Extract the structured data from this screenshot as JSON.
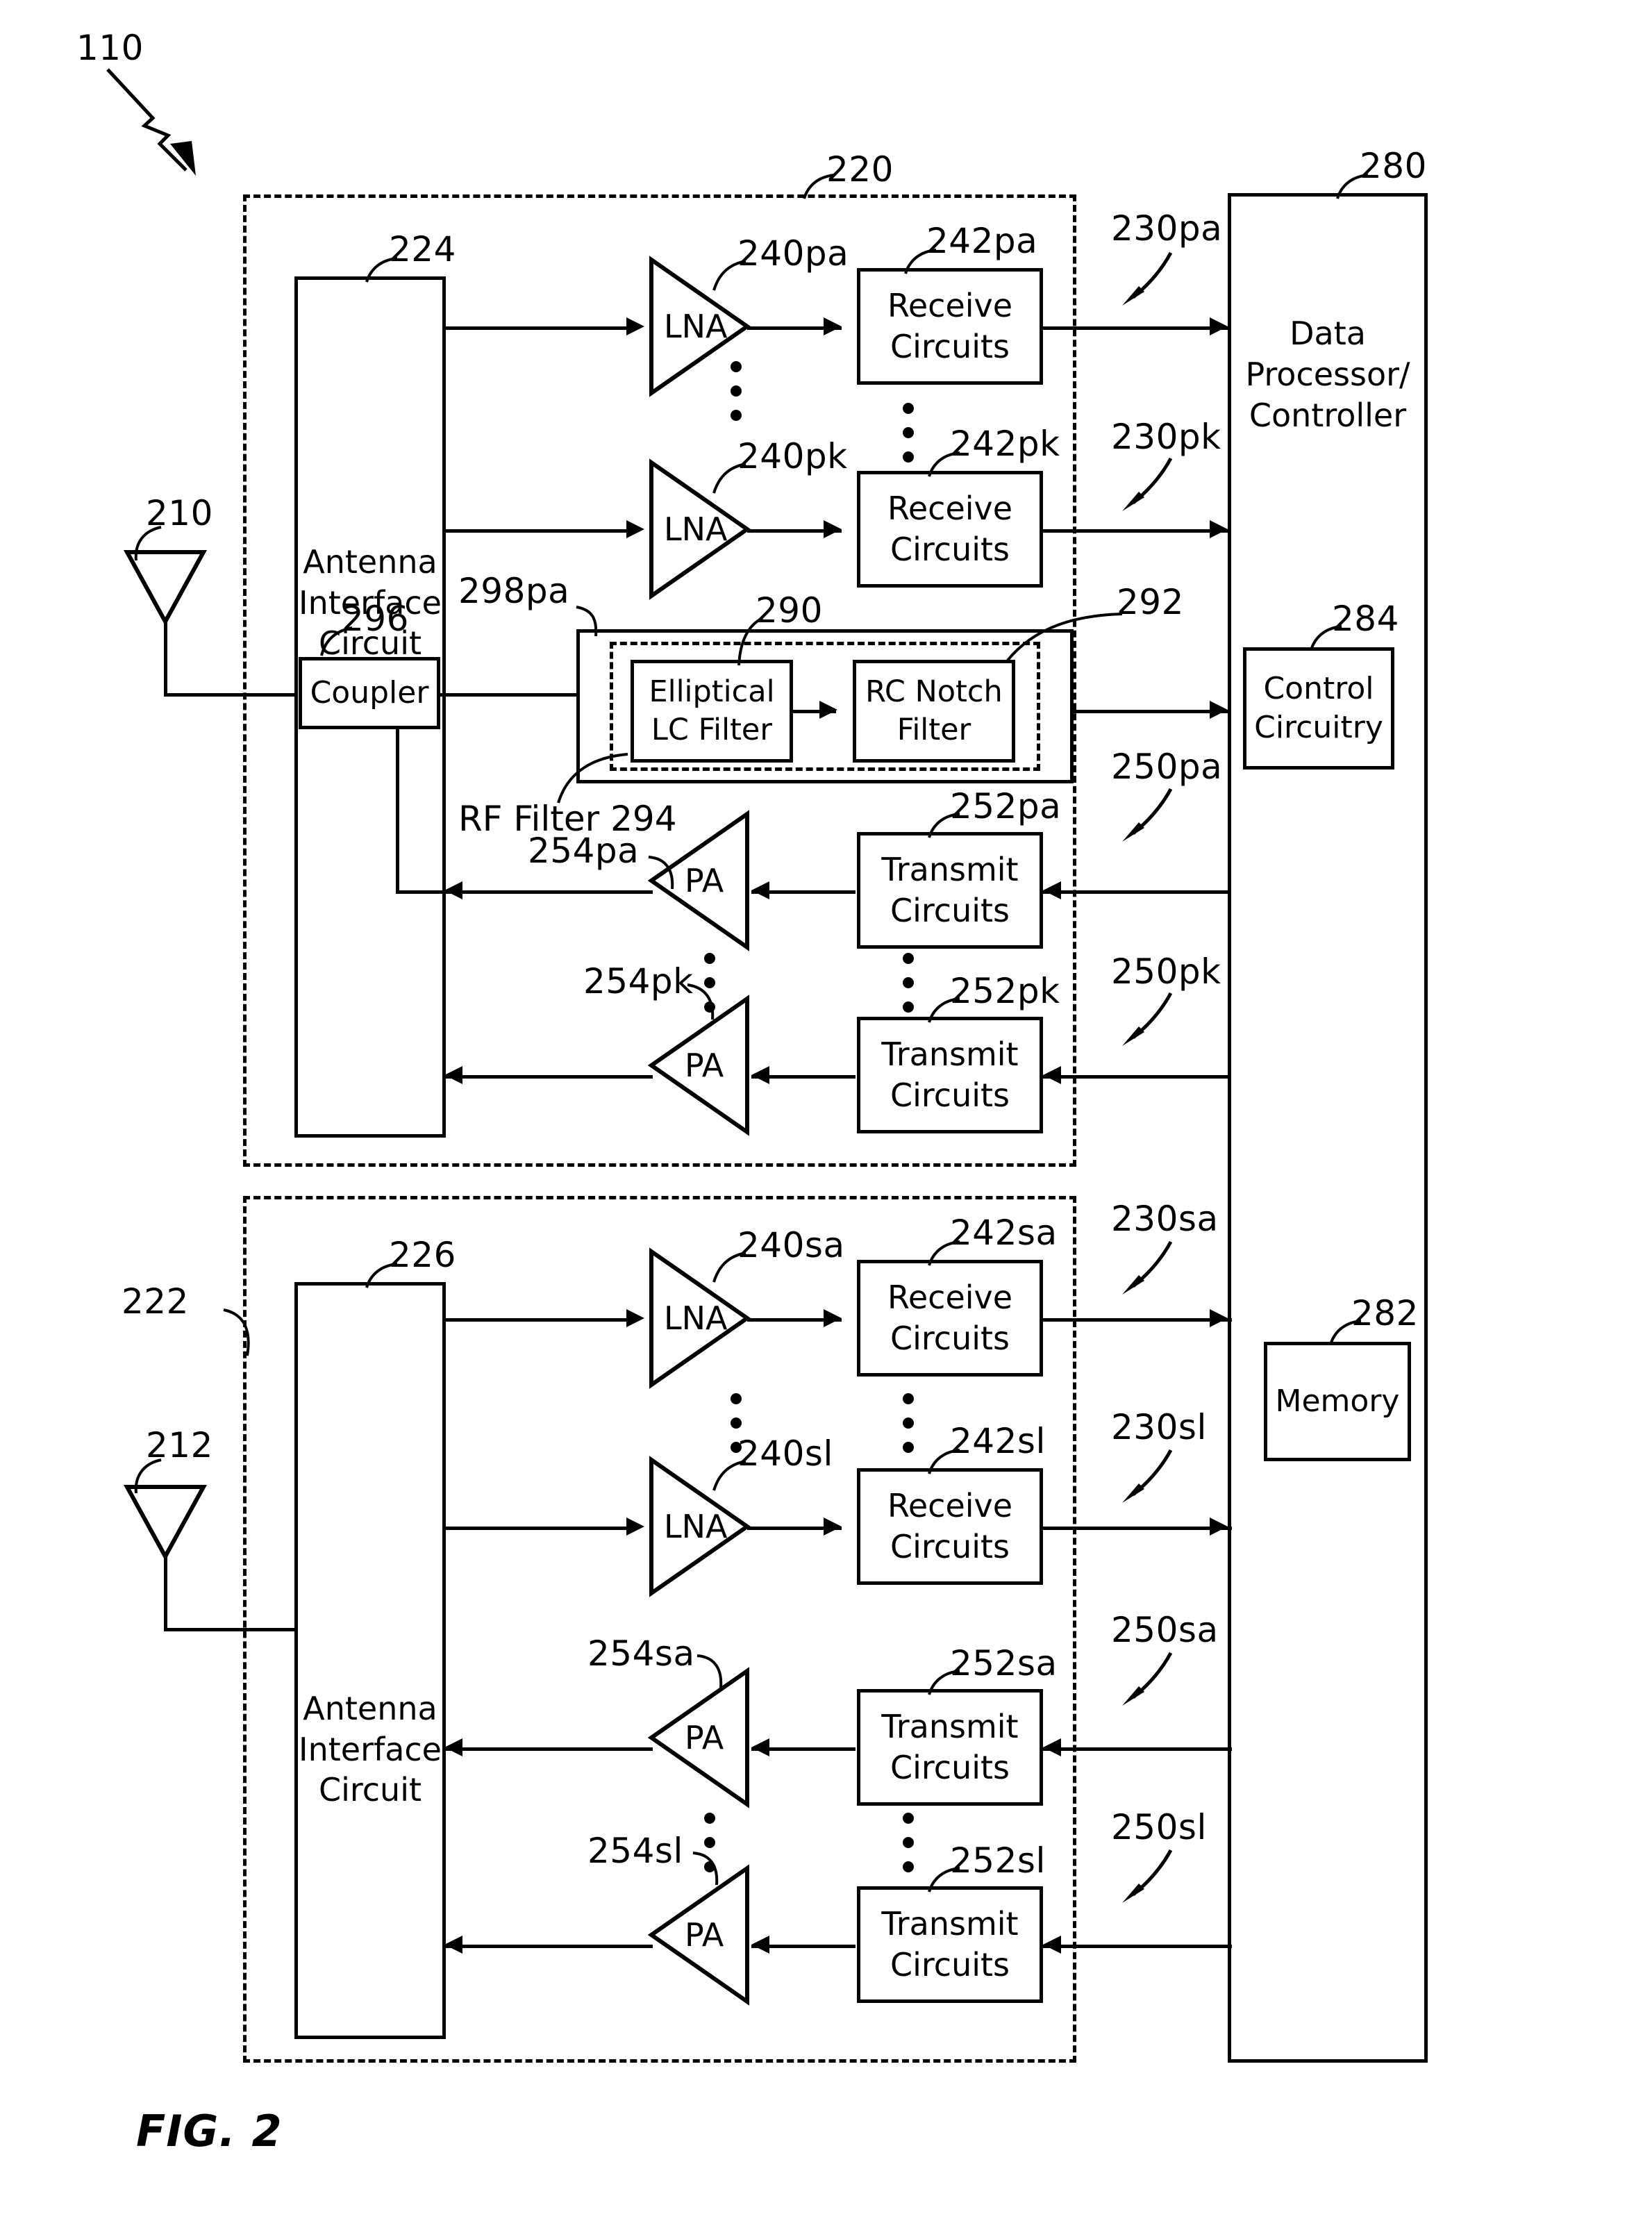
{
  "figure": {
    "caption": "FIG. 2",
    "title_ref": "110"
  },
  "refs": {
    "device": "110",
    "primary_transceiver": "220",
    "secondary_transceiver": "222",
    "antenna_primary": "210",
    "antenna_secondary": "212",
    "aic_primary": "224",
    "aic_secondary": "226",
    "coupler": "296",
    "rf_filter_path": "298pa",
    "elliptical_filter": "290",
    "rc_notch_filter": "292",
    "rf_filter": "RF Filter 294",
    "data_processor": "280",
    "memory": "282",
    "control_circuitry": "284",
    "lna_pa_first": "240pa",
    "lna_pa_last": "240pk",
    "rx_pa_first": "242pa",
    "rx_pa_last": "242pk",
    "rx_out_pa_first": "230pa",
    "rx_out_pa_last": "230pk",
    "pa_amp_first": "254pa",
    "pa_amp_last": "254pk",
    "tx_pa_first": "252pa",
    "tx_pa_last": "252pk",
    "tx_in_pa_first": "250pa",
    "tx_in_pa_last": "250pk",
    "lna_sa_first": "240sa",
    "lna_sa_last": "240sl",
    "rx_sa_first": "242sa",
    "rx_sa_last": "242sl",
    "rx_out_sa_first": "230sa",
    "rx_out_sa_last": "230sl",
    "pa_sa_first": "254sa",
    "pa_sa_last": "254sl",
    "tx_sa_first": "252sa",
    "tx_sa_last": "252sl",
    "tx_in_sa_first": "250sa",
    "tx_in_sa_last": "250sl"
  },
  "blocks": {
    "antenna_interface_circuit": "Antenna\nInterface\nCircuit",
    "antenna_interface_circuit_lines": [
      "Antenna",
      "Interface",
      "Circuit"
    ],
    "coupler": "Coupler",
    "lna": "LNA",
    "pa": "PA",
    "receive_circuits_lines": [
      "Receive",
      "Circuits"
    ],
    "transmit_circuits_lines": [
      "Transmit",
      "Circuits"
    ],
    "elliptical_lc_filter_lines": [
      "Elliptical",
      "LC Filter"
    ],
    "rc_notch_filter_lines": [
      "RC Notch",
      "Filter"
    ],
    "data_processor_lines": [
      "Data",
      "Processor/",
      "Controller"
    ],
    "memory": "Memory",
    "control_circuitry_lines": [
      "Control",
      "Circuitry"
    ]
  },
  "colors": {
    "stroke": "#000000",
    "background": "#ffffff"
  }
}
